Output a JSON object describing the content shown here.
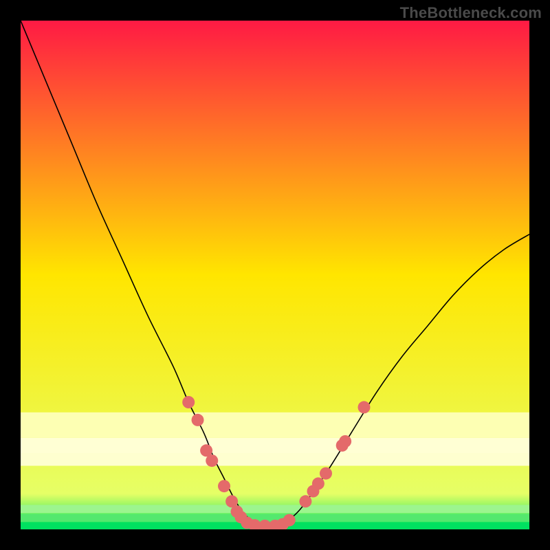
{
  "watermark": "TheBottleneck.com",
  "chart_data": {
    "type": "line",
    "title": "",
    "xlabel": "",
    "ylabel": "",
    "xlim": [
      0,
      100
    ],
    "ylim": [
      0,
      100
    ],
    "background_gradient": {
      "stops": [
        [
          0,
          "#ff1a44"
        ],
        [
          50,
          "#ffe600"
        ],
        [
          93,
          "#e6ff66"
        ],
        [
          99.8,
          "#00e65c"
        ],
        [
          100,
          "#00e65c"
        ]
      ]
    },
    "band_colors": {
      "yellow_pale": "#fdffb3",
      "cream": "#ffffd4",
      "cream2": "#feffcf",
      "green1": "#9cf58e",
      "green2": "#54e86e",
      "green3": "#00e160"
    },
    "series": [
      {
        "name": "bottleneck-curve",
        "color": "#000000",
        "x": [
          0,
          5,
          10,
          15,
          20,
          25,
          30,
          33,
          36,
          38,
          40,
          42,
          44,
          46,
          48,
          50,
          52,
          55,
          60,
          65,
          70,
          75,
          80,
          85,
          90,
          95,
          100
        ],
        "y": [
          100,
          88,
          76,
          64,
          53,
          42,
          32,
          25,
          19,
          14,
          10,
          6,
          3,
          1.5,
          0.7,
          0.7,
          1.5,
          4,
          11,
          19,
          27,
          34,
          40,
          46,
          51,
          55,
          58
        ]
      }
    ],
    "markers": {
      "name": "highlighted-points",
      "color": "#e46a6a",
      "radius": 9,
      "points": [
        {
          "x": 33,
          "y": 25
        },
        {
          "x": 34.8,
          "y": 21.5
        },
        {
          "x": 36.5,
          "y": 15.5
        },
        {
          "x": 37.6,
          "y": 13.5
        },
        {
          "x": 40,
          "y": 8.5
        },
        {
          "x": 41.5,
          "y": 5.5
        },
        {
          "x": 42.5,
          "y": 3.5
        },
        {
          "x": 43.3,
          "y": 2.4
        },
        {
          "x": 44.5,
          "y": 1.3
        },
        {
          "x": 46,
          "y": 0.8
        },
        {
          "x": 48,
          "y": 0.7
        },
        {
          "x": 50,
          "y": 0.7
        },
        {
          "x": 51.5,
          "y": 1.0
        },
        {
          "x": 52.8,
          "y": 1.8
        },
        {
          "x": 56,
          "y": 5.5
        },
        {
          "x": 57.5,
          "y": 7.5
        },
        {
          "x": 58.5,
          "y": 9
        },
        {
          "x": 60,
          "y": 11
        },
        {
          "x": 63.2,
          "y": 16.5
        },
        {
          "x": 63.8,
          "y": 17.3
        },
        {
          "x": 67.5,
          "y": 24
        }
      ]
    }
  }
}
